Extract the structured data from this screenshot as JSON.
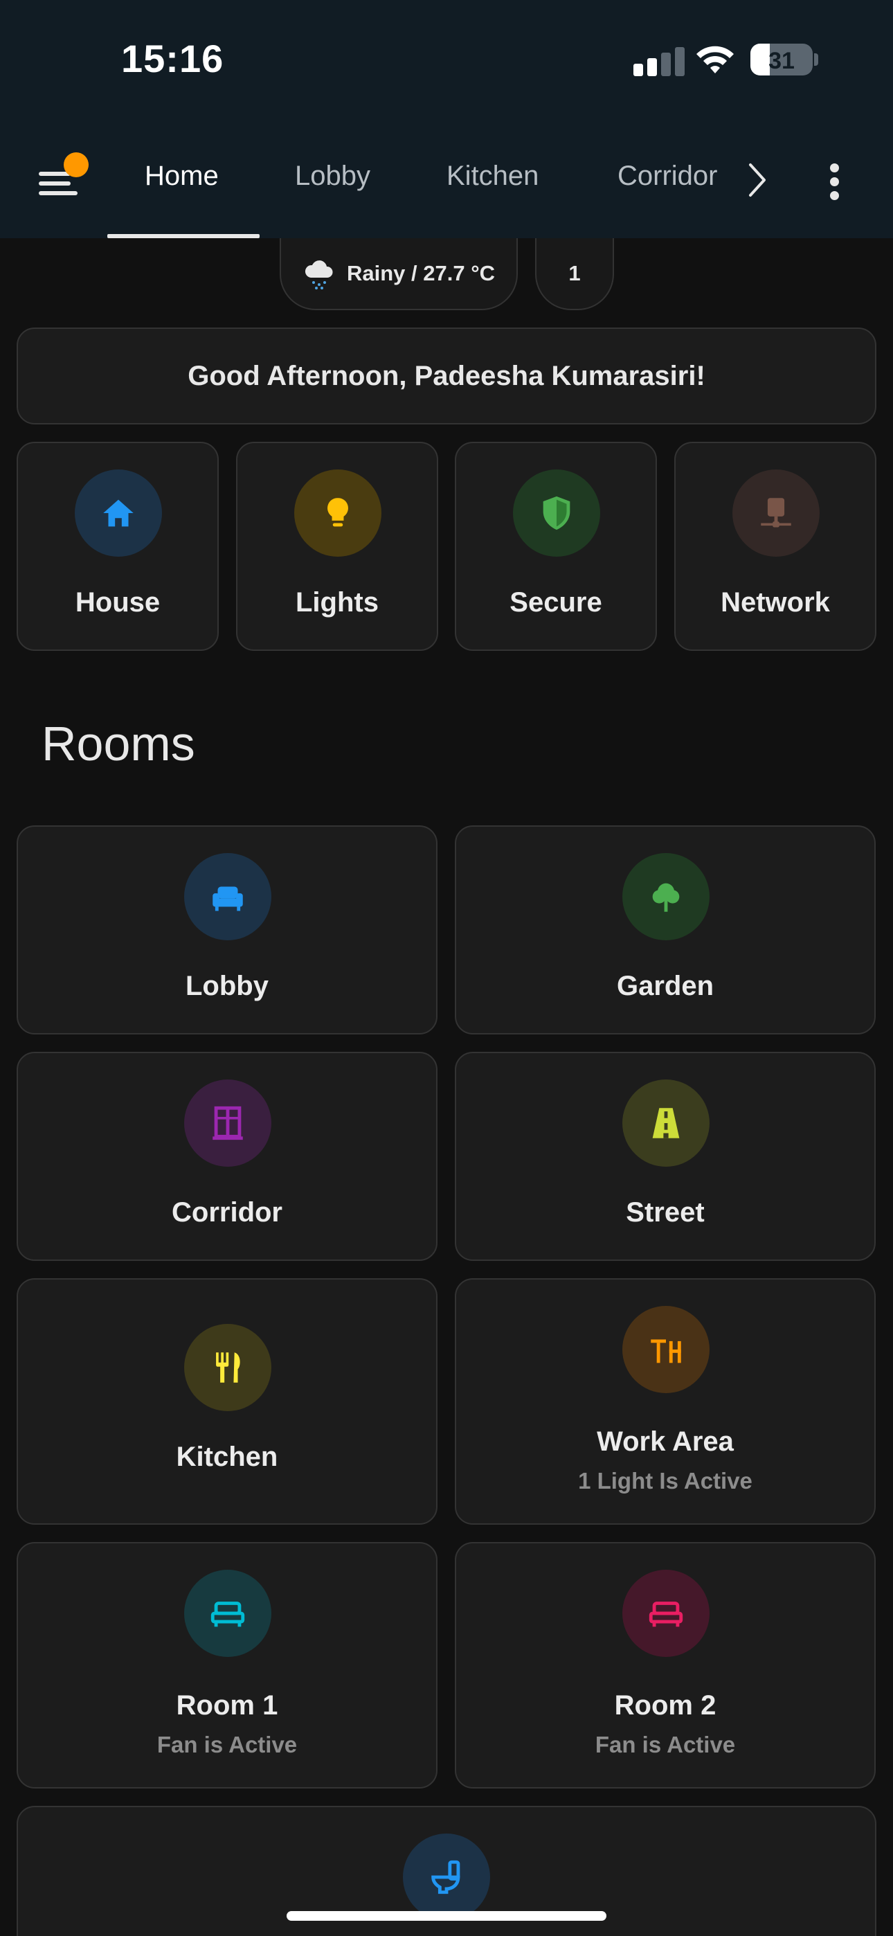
{
  "status_bar": {
    "time": "15:16",
    "battery": "31"
  },
  "nav": {
    "tabs": [
      {
        "label": "Home",
        "active": true
      },
      {
        "label": "Lobby",
        "active": false
      },
      {
        "label": "Kitchen",
        "active": false
      },
      {
        "label": "Corridor",
        "active": false
      }
    ]
  },
  "chips": {
    "weather": "Rainy / 27.7 °C",
    "count": "1"
  },
  "greeting": "Good Afternoon, Padeesha Kumarasiri!",
  "summary": [
    {
      "label": "House",
      "icon": "home-icon",
      "color": "#2196f3"
    },
    {
      "label": "Lights",
      "icon": "lightbulb-icon",
      "color": "#ffc107"
    },
    {
      "label": "Secure",
      "icon": "shield-icon",
      "color": "#4caf50"
    },
    {
      "label": "Network",
      "icon": "network-icon",
      "color": "#795548"
    }
  ],
  "rooms_title": "Rooms",
  "rooms": [
    {
      "label": "Lobby",
      "sub": "",
      "icon": "sofa-icon",
      "color": "#2196f3"
    },
    {
      "label": "Garden",
      "sub": "",
      "icon": "tree-icon",
      "color": "#4caf50"
    },
    {
      "label": "Corridor",
      "sub": "",
      "icon": "door-icon",
      "color": "#9c27b0"
    },
    {
      "label": "Street",
      "sub": "",
      "icon": "road-icon",
      "color": "#cddc39"
    },
    {
      "label": "Kitchen",
      "sub": "",
      "icon": "utensils-icon",
      "color": "#ffeb3b"
    },
    {
      "label": "Work Area",
      "sub": "1 Light Is Active",
      "icon": "desk-icon",
      "color": "#ff9800"
    },
    {
      "label": "Room 1",
      "sub": "Fan is Active",
      "icon": "bed-icon",
      "color": "#00bcd4"
    },
    {
      "label": "Room 2",
      "sub": "Fan is Active",
      "icon": "bed-icon",
      "color": "#e91e63"
    },
    {
      "label": "",
      "sub": "",
      "icon": "toilet-icon",
      "color": "#2196f3"
    }
  ]
}
